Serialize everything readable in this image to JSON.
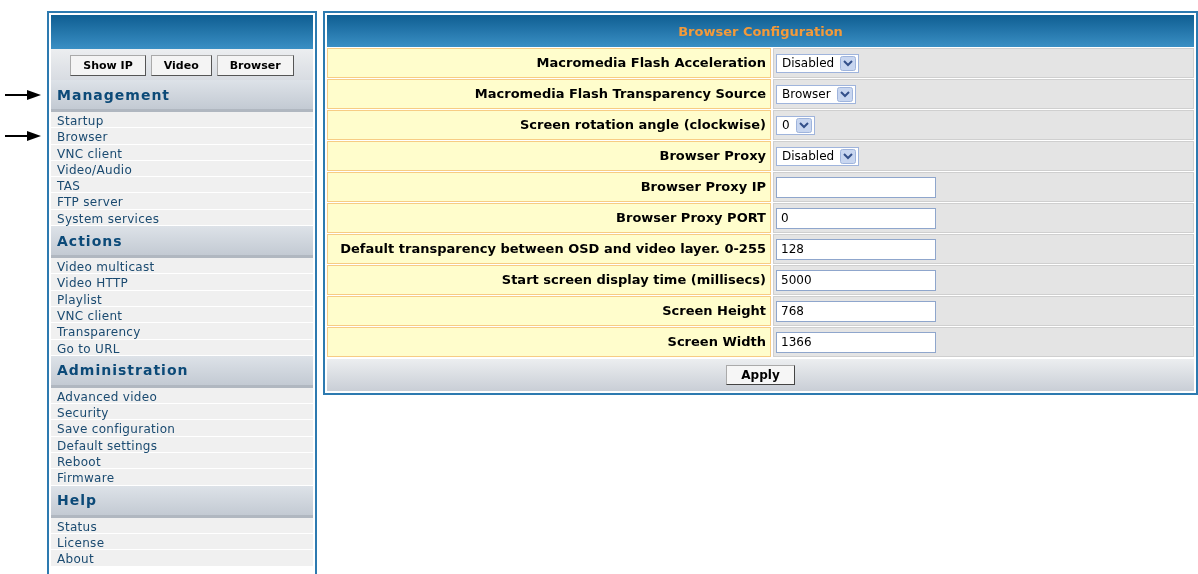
{
  "sidebar": {
    "buttons": [
      "Show IP",
      "Video",
      "Browser"
    ],
    "sections": [
      {
        "title": "Management",
        "arrow": true,
        "items": [
          {
            "label": "Startup",
            "arrow": false
          },
          {
            "label": "Browser",
            "arrow": true
          },
          {
            "label": "VNC client",
            "arrow": false
          },
          {
            "label": "Video/Audio",
            "arrow": false
          },
          {
            "label": "TAS",
            "arrow": false
          },
          {
            "label": "FTP server",
            "arrow": false
          },
          {
            "label": "System services",
            "arrow": false
          }
        ]
      },
      {
        "title": "Actions",
        "arrow": false,
        "items": [
          {
            "label": "Video multicast",
            "arrow": false
          },
          {
            "label": "Video HTTP",
            "arrow": false
          },
          {
            "label": "Playlist",
            "arrow": false
          },
          {
            "label": "VNC client",
            "arrow": false
          },
          {
            "label": "Transparency",
            "arrow": false
          },
          {
            "label": "Go to URL",
            "arrow": false
          }
        ]
      },
      {
        "title": "Administration",
        "arrow": false,
        "items": [
          {
            "label": "Advanced video",
            "arrow": false
          },
          {
            "label": "Security",
            "arrow": false
          },
          {
            "label": "Save configuration",
            "arrow": false
          },
          {
            "label": "Default settings",
            "arrow": false
          },
          {
            "label": "Reboot",
            "arrow": false
          },
          {
            "label": "Firmware",
            "arrow": false
          }
        ]
      },
      {
        "title": "Help",
        "arrow": false,
        "items": [
          {
            "label": "Status",
            "arrow": false
          },
          {
            "label": "License",
            "arrow": false
          },
          {
            "label": "About",
            "arrow": false
          }
        ]
      }
    ]
  },
  "panel": {
    "title": "Browser Configuration",
    "fields": [
      {
        "label": "Macromedia Flash Acceleration",
        "kind": "select",
        "value": "Disabled"
      },
      {
        "label": "Macromedia Flash Transparency Source",
        "kind": "select",
        "value": "Browser"
      },
      {
        "label": "Screen rotation angle (clockwise)",
        "kind": "select",
        "value": "0"
      },
      {
        "label": "Browser Proxy",
        "kind": "select",
        "value": "Disabled"
      },
      {
        "label": "Browser Proxy IP",
        "kind": "text"
      },
      {
        "label": "Browser Proxy PORT",
        "kind": "text",
        "value": "0"
      },
      {
        "label": "Default transparency between OSD and video layer. 0-255",
        "kind": "text",
        "value": "128"
      },
      {
        "label": "Start screen display time (millisecs)",
        "kind": "text",
        "value": "5000"
      },
      {
        "label": "Screen Height",
        "kind": "text",
        "value": "768"
      },
      {
        "label": "Screen Width",
        "kind": "text",
        "value": "1366"
      }
    ],
    "apply_button": "Apply"
  }
}
